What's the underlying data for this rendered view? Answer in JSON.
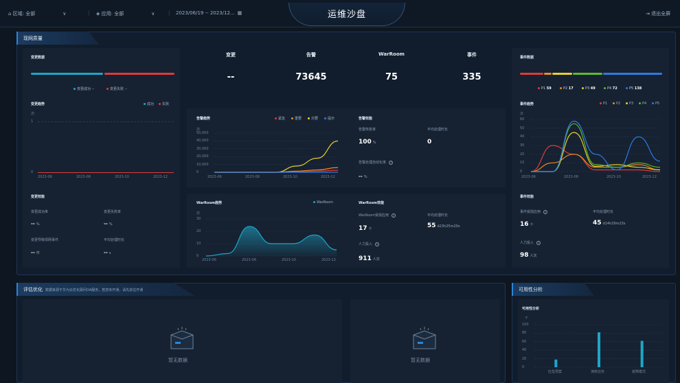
{
  "topbar": {
    "region": "区域: 全部",
    "app": "应用: 全部",
    "date_range": "2023/06/19 -- 2023/12...",
    "title": "运维沙盘",
    "exit": "退出全屏"
  },
  "network": {
    "tab": "现网质量",
    "change_data": {
      "title": "变更数据",
      "legend_success": "变更成功 --",
      "legend_fail": "变更失败 --"
    },
    "change_trend": {
      "title": "变更趋势",
      "legend": [
        "成功",
        "失败"
      ],
      "unit": "次",
      "y_ticks": [
        "1",
        "0"
      ],
      "x_ticks": [
        "2023-06",
        "2023-08",
        "2023-10",
        "2023-12"
      ]
    },
    "change_effect": {
      "title": "变更效能",
      "success_rate_label": "变更成功率",
      "success_rate_value": "--",
      "success_rate_unit": "%",
      "fail_rate_label": "变更失败率",
      "fail_rate_value": "--",
      "fail_rate_unit": "%",
      "incident_label": "变更导致现网事件",
      "incident_value": "--",
      "incident_unit": "件",
      "avg_label": "平均处理时长",
      "avg_value": "--",
      "avg_unit": "s"
    },
    "summary": [
      {
        "label": "变更",
        "value": "--"
      },
      {
        "label": "告警",
        "value": "73645"
      },
      {
        "label": "WarRoom",
        "value": "75"
      },
      {
        "label": "事件",
        "value": "335"
      }
    ],
    "alarm_trend": {
      "title": "告警趋势",
      "legend": [
        "紧急",
        "重要",
        "次要",
        "提示"
      ],
      "unit": "次",
      "y_ticks": [
        "50,000",
        "40,000",
        "30,000",
        "20,000",
        "10,000",
        "0"
      ],
      "x_ticks": [
        "2023-06",
        "2023-08",
        "2023-10",
        "2023-12"
      ]
    },
    "alarm_effect": {
      "title": "告警效能",
      "recover_label": "告警恢复率",
      "recover_value": "100",
      "recover_unit": "%",
      "avg_label": "平均处理时长",
      "avg_value": "0",
      "auto_label": "告警处理自动化率",
      "auto_value": "--",
      "auto_unit": "%"
    },
    "warroom_trend": {
      "title": "WarRoom趋势",
      "legend": "WarRoom",
      "unit": "次",
      "y_ticks": [
        "30",
        "20",
        "10",
        "0"
      ],
      "x_ticks": [
        "2023-06",
        "2023-08",
        "2023-10",
        "2023-12"
      ]
    },
    "warroom_effect": {
      "title": "WarRoom效能",
      "app_label": "WarRoom受损应用",
      "app_value": "17",
      "app_unit": "个",
      "avg_label": "平均处理时长",
      "avg_value": "55",
      "avg_unit": "d23h25m20s",
      "people_label": "人力投入",
      "people_value": "911",
      "people_unit": "人次"
    },
    "event_data": {
      "title": "事件数据",
      "levels": [
        {
          "name": "P1",
          "value": "59"
        },
        {
          "name": "P2",
          "value": "17"
        },
        {
          "name": "P3",
          "value": "49"
        },
        {
          "name": "P4",
          "value": "72"
        },
        {
          "name": "P5",
          "value": "138"
        }
      ]
    },
    "event_trend": {
      "title": "事件趋势",
      "legend": [
        "P1",
        "P2",
        "P3",
        "P4",
        "P5"
      ],
      "unit": "次",
      "y_ticks": [
        "60",
        "50",
        "40",
        "30",
        "20",
        "10",
        "0"
      ],
      "x_ticks": [
        "2023-06",
        "2023-08",
        "2023-10",
        "2023-12"
      ]
    },
    "event_effect": {
      "title": "事件效能",
      "app_label": "事件受损应用",
      "app_value": "16",
      "app_unit": "个",
      "avg_label": "平均处理时长",
      "avg_value": "45",
      "avg_unit": "d14h29m23s",
      "people_label": "人力投入",
      "people_value": "98",
      "people_unit": "人次"
    }
  },
  "evaluate": {
    "tab": "评估优化",
    "desc": "数据来源于华为云优化顾问OA服务，若您未开通，请先前往开通",
    "empty1": "暂无数据",
    "empty2": "暂无数据"
  },
  "availability": {
    "tab": "可用性分析",
    "title": "可用性分析",
    "unit": "个",
    "y_ticks": [
      "100",
      "80",
      "60",
      "40",
      "20",
      "0"
    ],
    "categories": [
      "应急预案",
      "演练任务",
      "故障模式"
    ]
  },
  "colors": {
    "accent": "#2b86d6",
    "p1": "#e03a3a",
    "p2": "#f08a24",
    "p3": "#e8d02a",
    "p4": "#5dbb2a",
    "p5": "#2f7ae5",
    "teal": "#1ea6c7"
  },
  "chart_data": [
    {
      "type": "line",
      "title": "告警趋势",
      "x": [
        "2023-06",
        "2023-07",
        "2023-08",
        "2023-09",
        "2023-10",
        "2023-11",
        "2023-12"
      ],
      "ylim": [
        0,
        50000
      ],
      "series": [
        {
          "name": "紧急",
          "values": [
            0,
            0,
            0,
            0,
            500,
            1500,
            2500
          ]
        },
        {
          "name": "重要",
          "values": [
            0,
            0,
            0,
            0,
            1500,
            3000,
            6000
          ]
        },
        {
          "name": "次要",
          "values": [
            0,
            0,
            0,
            0,
            8000,
            18000,
            40000
          ]
        },
        {
          "name": "提示",
          "values": [
            0,
            0,
            0,
            0,
            0,
            0,
            0
          ]
        }
      ]
    },
    {
      "type": "area",
      "title": "WarRoom趋势",
      "x": [
        "2023-06",
        "2023-07",
        "2023-08",
        "2023-09",
        "2023-10",
        "2023-11",
        "2023-12"
      ],
      "ylim": [
        0,
        30
      ],
      "series": [
        {
          "name": "WarRoom",
          "values": [
            0,
            2,
            24,
            10,
            10,
            17,
            5
          ]
        }
      ]
    },
    {
      "type": "line",
      "title": "事件趋势",
      "x": [
        "2023-06",
        "2023-07",
        "2023-08",
        "2023-09",
        "2023-10",
        "2023-11",
        "2023-12"
      ],
      "ylim": [
        0,
        60
      ],
      "series": [
        {
          "name": "P1",
          "values": [
            0,
            30,
            20,
            2,
            2,
            2,
            0
          ]
        },
        {
          "name": "P2",
          "values": [
            0,
            10,
            20,
            5,
            5,
            8,
            2
          ]
        },
        {
          "name": "P3",
          "values": [
            0,
            0,
            45,
            6,
            8,
            5,
            2
          ]
        },
        {
          "name": "P4",
          "values": [
            0,
            0,
            55,
            8,
            5,
            10,
            5
          ]
        },
        {
          "name": "P5",
          "values": [
            0,
            0,
            58,
            20,
            2,
            40,
            12
          ]
        }
      ]
    },
    {
      "type": "bar",
      "title": "可用性分析",
      "categories": [
        "应急预案",
        "演练任务",
        "故障模式"
      ],
      "values": [
        18,
        82,
        62
      ],
      "ylim": [
        0,
        100
      ]
    }
  ]
}
